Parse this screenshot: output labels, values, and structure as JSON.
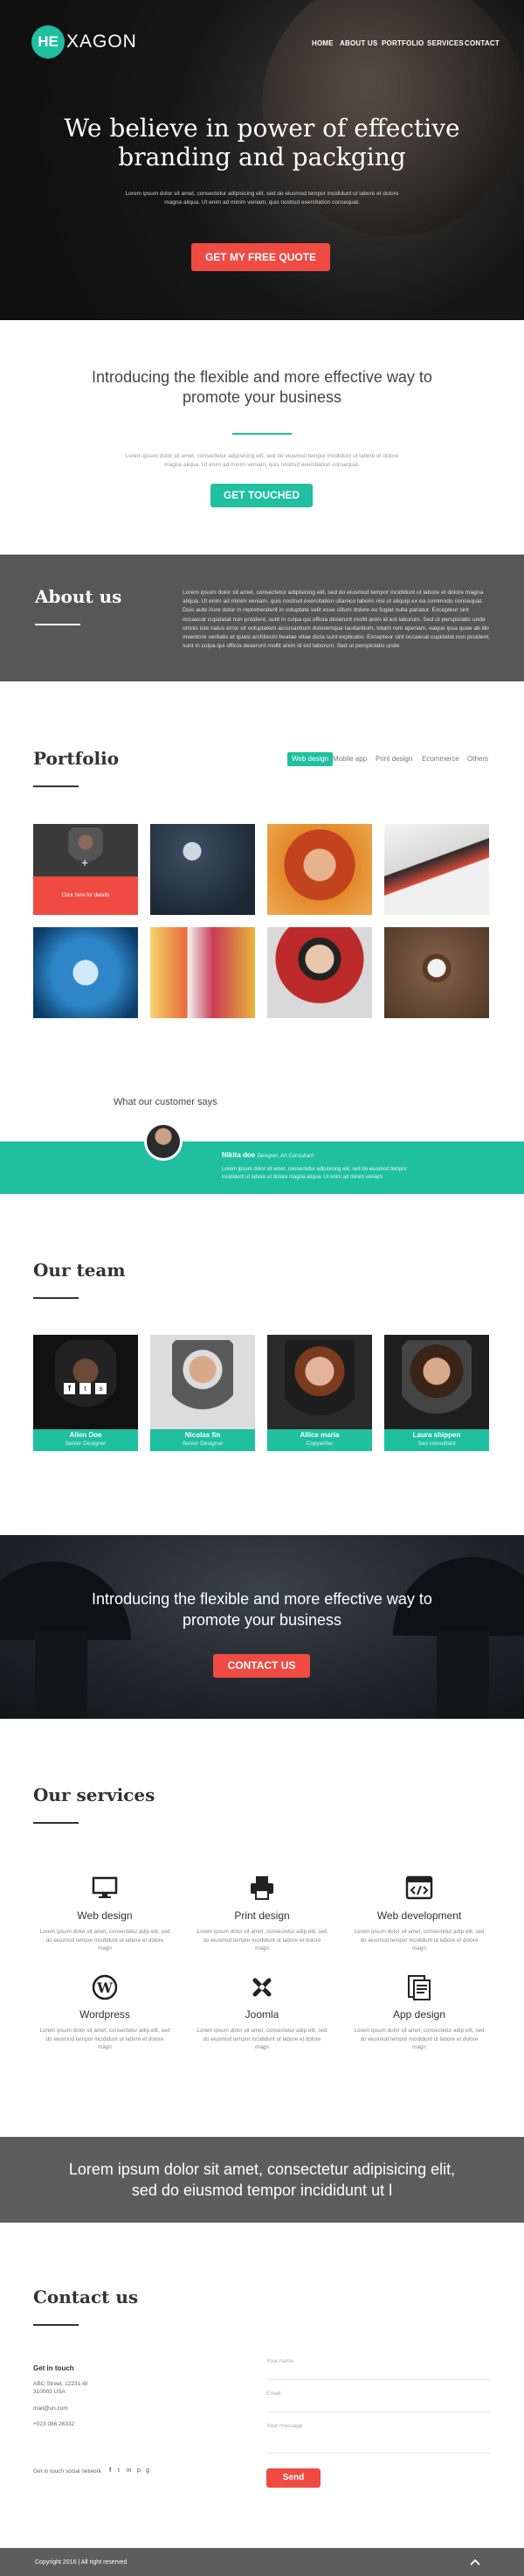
{
  "brand": {
    "badge": "HE",
    "rest": "XAGON"
  },
  "nav": [
    "HOME",
    "ABOUT US",
    "PORTFOLIO",
    "SERVICES",
    "CONTACT"
  ],
  "hero": {
    "title_line1": "We believe in power of effective",
    "title_line2": "branding and packging",
    "text": "Lorem ipsum dolor sit amet, consectetur adipisicing elit, sed do eiusmod tempor incididunt ut labore et dolore magna aliqua. Ut enim ad minim veniam, quis nostrud exercitation consequat.",
    "button": "GET MY FREE QUOTE"
  },
  "intro": {
    "title_line1": "Introducing the flexible and more effective way to",
    "title_line2": "promote your business",
    "text": "Lorem ipsum dolor sit amet, consectetur adipisicing elit, sed do eiusmod tempor incididunt ut labore et dolore magna aliqua. Ut enim ad minim veniam, quis nostrud exercitation consequat.",
    "button": "GET TOUCHED"
  },
  "about": {
    "title": "About us",
    "text": "Lorem ipsum dolor sit amet, consectetur adipisicing elit, sed do eiusmod tempor incididunt ut labore et dolore magna aliqua. Ut enim ad minim veniam, quis nostrud exercitation ullamco laboris nisi ut aliquip ex ea commodo consequat. Duis aute irure dolor in reprehenderit in voluptate velit esse cillum dolore eu fugiat nulla pariatur. Excepteur sint occaecat cupidatat non proident, sunt in culpa qui officia deserunt mollit anim id est laborum. Sed ut perspiciatis unde omnis iste natus error sit voluptatem accusantium doloremque laudantium, totam rem aperiam, eaque ipsa quae ab illo inventore veritatis et quasi architecto beatae vitae dicta sunt explicabo. Excepteur sint occaecat cupidatat non proident, sunt in culpa qui officia deserunt mollit anim id est laborum. Sed ut perspiciatis unde"
  },
  "portfolio": {
    "title": "Portfolio",
    "filters": [
      "Web design",
      "Mobile app",
      "Print design",
      "Ecommerce",
      "Others"
    ],
    "active_filter": "Web design",
    "overlay_text": "Click here for details"
  },
  "testimonial": {
    "heading": "What our customer says",
    "name": "Nikita doe",
    "role": "Designer, Art Consultant",
    "text": "Lorem ipsum dolor sit amet, consectetur adipisicing elit, sed do eiusmod tempor incididunt ut labore et dolore magna aliqua. Ut enim ad minim veniam"
  },
  "team": {
    "title": "Our team",
    "members": [
      {
        "name": "Allen Doe",
        "role": "Senior Designer"
      },
      {
        "name": "Nicolas fin",
        "role": "Senior Designer"
      },
      {
        "name": "Allice maria",
        "role": "Copywriter"
      },
      {
        "name": "Laura shippen",
        "role": "Seo consultant"
      }
    ]
  },
  "parallax": {
    "title_line1": "Introducing the flexible and more effective way to",
    "title_line2": "promote your business",
    "button": "CONTACT US"
  },
  "services": {
    "title": "Our services",
    "text": "Lorem ipsum dolor sit amet, consectetur adip elit, sed do eiusmod tempor incididunt ut labore et dolore magn",
    "items": [
      {
        "name": "Web design",
        "icon": "monitor-icon"
      },
      {
        "name": "Print design",
        "icon": "printer-icon"
      },
      {
        "name": "Web development",
        "icon": "code-window-icon"
      },
      {
        "name": "Wordpress",
        "icon": "wordpress-icon"
      },
      {
        "name": "Joomla",
        "icon": "joomla-icon"
      },
      {
        "name": "App design",
        "icon": "app-design-icon"
      }
    ]
  },
  "band": {
    "line1": "Lorem ipsum dolor sit amet, consectetur adipisicing elit,",
    "line2": "sed do eiusmod tempor incididunt ut l"
  },
  "contact": {
    "title": "Contact us",
    "get_in_touch": "Get in touch",
    "address1": "ABC Street, 12231-W",
    "address2": "310003 USA",
    "email": "mail@un.com",
    "phone": "+023 086 26332",
    "social_label": "Get in touch social network",
    "placeholders": {
      "name": "Your name",
      "email": "Email",
      "message": "Your message"
    },
    "send": "Send"
  },
  "footer": {
    "copyright": "Copyright 2016  |  All right reserved"
  },
  "colors": {
    "accent": "#1fbf9f",
    "red": "#ef4b43",
    "dark_band": "#575757"
  }
}
